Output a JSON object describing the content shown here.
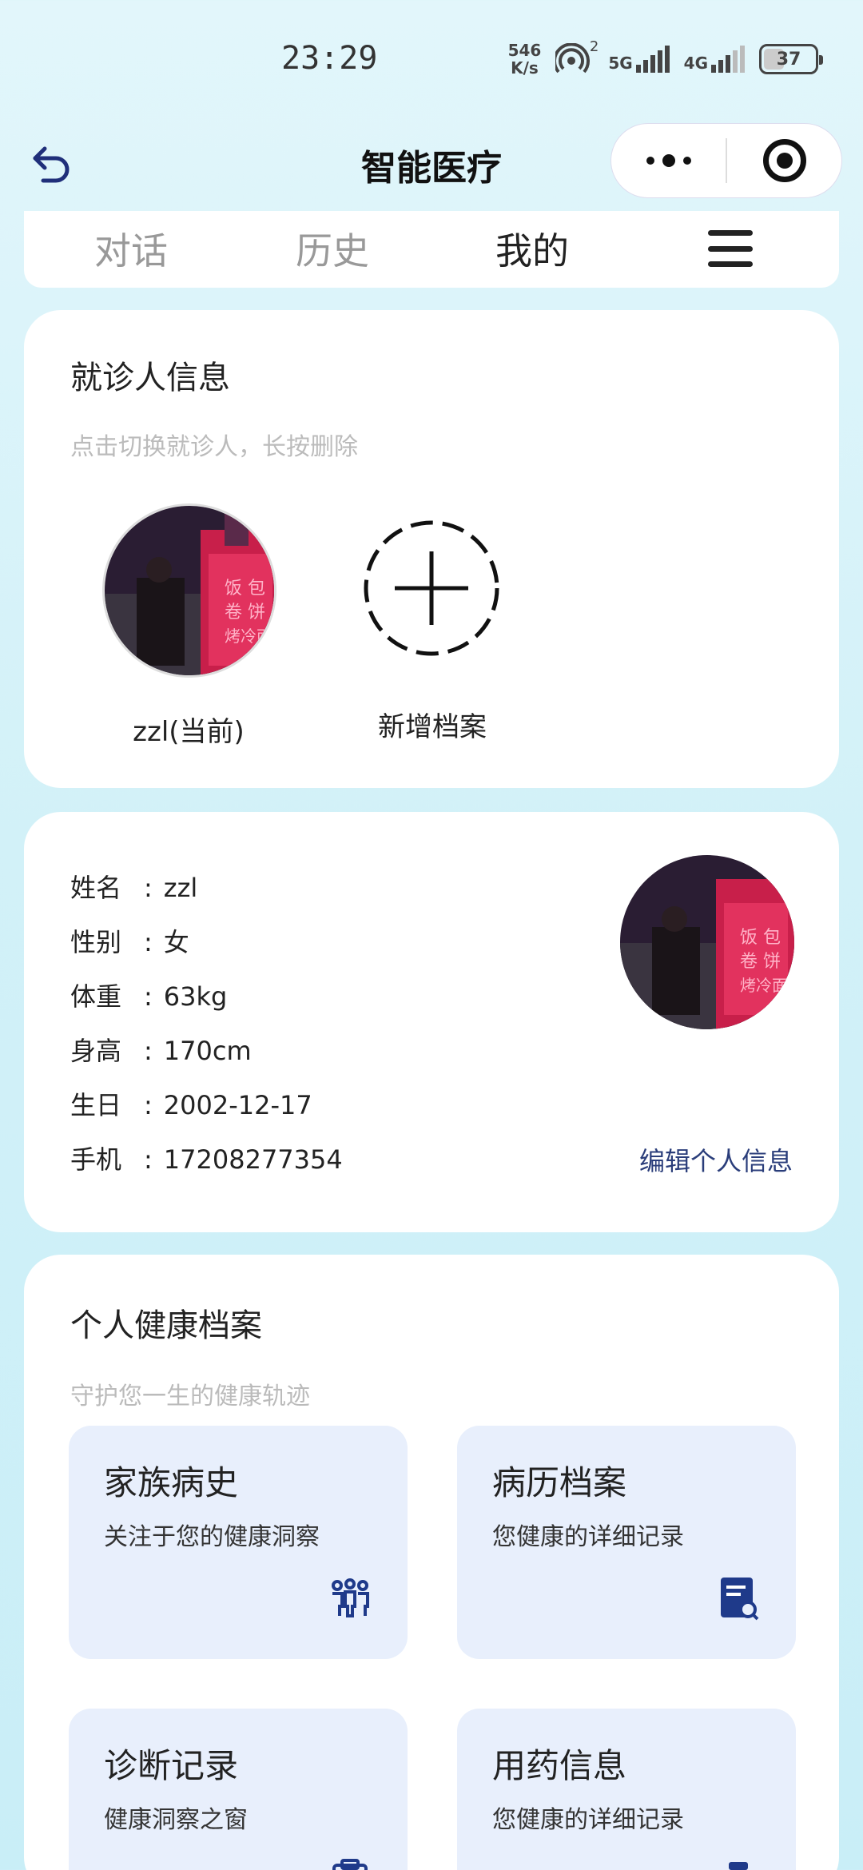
{
  "status": {
    "time": "23:29",
    "net_speed_value": "546",
    "net_speed_unit": "K/s",
    "hotspot_count": "2",
    "sim1": "5G",
    "sim2": "4G",
    "battery": "37"
  },
  "titlebar": {
    "title": "智能医疗"
  },
  "tabs": [
    {
      "label": "对话"
    },
    {
      "label": "历史"
    },
    {
      "label": "我的"
    }
  ],
  "patient_card": {
    "title": "就诊人信息",
    "subtitle": "点击切换就诊人，长按删除",
    "current_patient": "zzl(当前)",
    "add_label": "新增档案"
  },
  "info_card": {
    "separator": ":",
    "rows": [
      {
        "label": "姓名",
        "value": "zzl"
      },
      {
        "label": "性别",
        "value": "女"
      },
      {
        "label": "体重",
        "value": "63kg"
      },
      {
        "label": "身高",
        "value": "170cm"
      },
      {
        "label": "生日",
        "value": "2002-12-17"
      },
      {
        "label": "手机",
        "value": "17208277354"
      }
    ],
    "edit_label": "编辑个人信息"
  },
  "health_card": {
    "title": "个人健康档案",
    "subtitle": "守护您一生的健康轨迹",
    "tiles": [
      {
        "title": "家族病史",
        "desc": "关注于您的健康洞察",
        "icon": "family-icon"
      },
      {
        "title": "病历档案",
        "desc": "您健康的详细记录",
        "icon": "document-search-icon"
      },
      {
        "title": "诊断记录",
        "desc": "健康洞察之窗",
        "icon": "clipboard-icon"
      },
      {
        "title": "用药信息",
        "desc": "您健康的详细记录",
        "icon": "medicine-bottle-icon"
      }
    ]
  },
  "colors": {
    "accent": "#2a3d7a",
    "tile_bg": "#e8effc",
    "muted": "#bbbbbb"
  }
}
